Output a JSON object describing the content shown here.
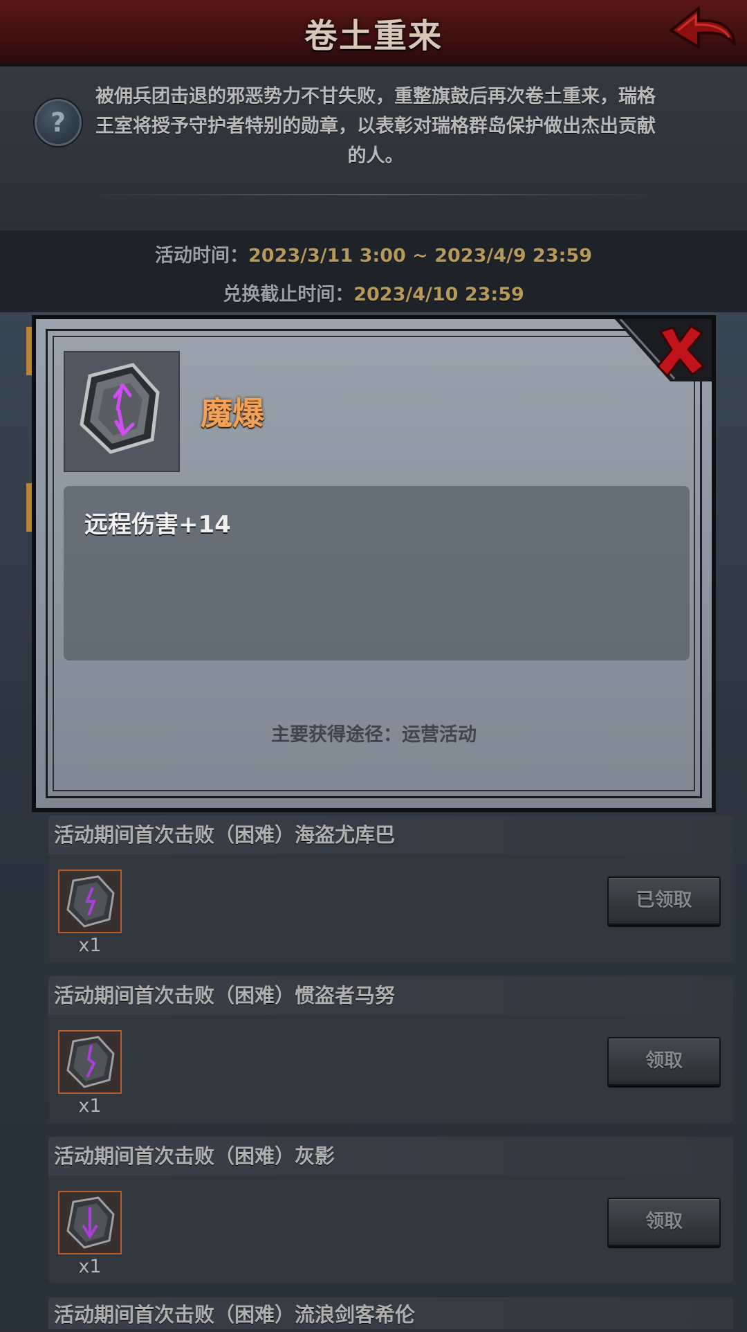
{
  "header": {
    "title": "卷土重来"
  },
  "description": {
    "text": "被佣兵团击退的邪恶势力不甘失败，重整旗鼓后再次卷土重来，瑞格王室将授予守护者特别的勋章，以表彰对瑞格群岛保护做出杰出贡献的人。"
  },
  "time": {
    "activity_label": "活动时间：",
    "activity_value": "2023/3/11 3:00 ~ 2023/4/9 23:59",
    "exchange_label": "兑换截止时间：",
    "exchange_value": "2023/4/10 23:59"
  },
  "tasks": [
    {
      "title": "活动期间首次击败（困难）海盗尤库巴",
      "count": "x1",
      "button": "已领取"
    },
    {
      "title": "活动期间首次击败（困难）惯盗者马努",
      "count": "x1",
      "button": "领取"
    },
    {
      "title": "活动期间首次击败（困难）灰影",
      "count": "x1",
      "button": "领取"
    },
    {
      "title": "活动期间首次击败（困难）流浪剑客希伦"
    }
  ],
  "modal": {
    "item_name": "魔爆",
    "effect": "远程伤害+14",
    "source": "主要获得途径：运营活动"
  },
  "colors": {
    "item_name": "#f2a257",
    "time_value": "#b79a5a",
    "close_red": "#c0141a",
    "header_red": "#5a1616"
  },
  "icons": {
    "back": "back-arrow-icon",
    "help": "question-icon",
    "close": "close-x-icon",
    "rune": "purple-rune-icon"
  }
}
